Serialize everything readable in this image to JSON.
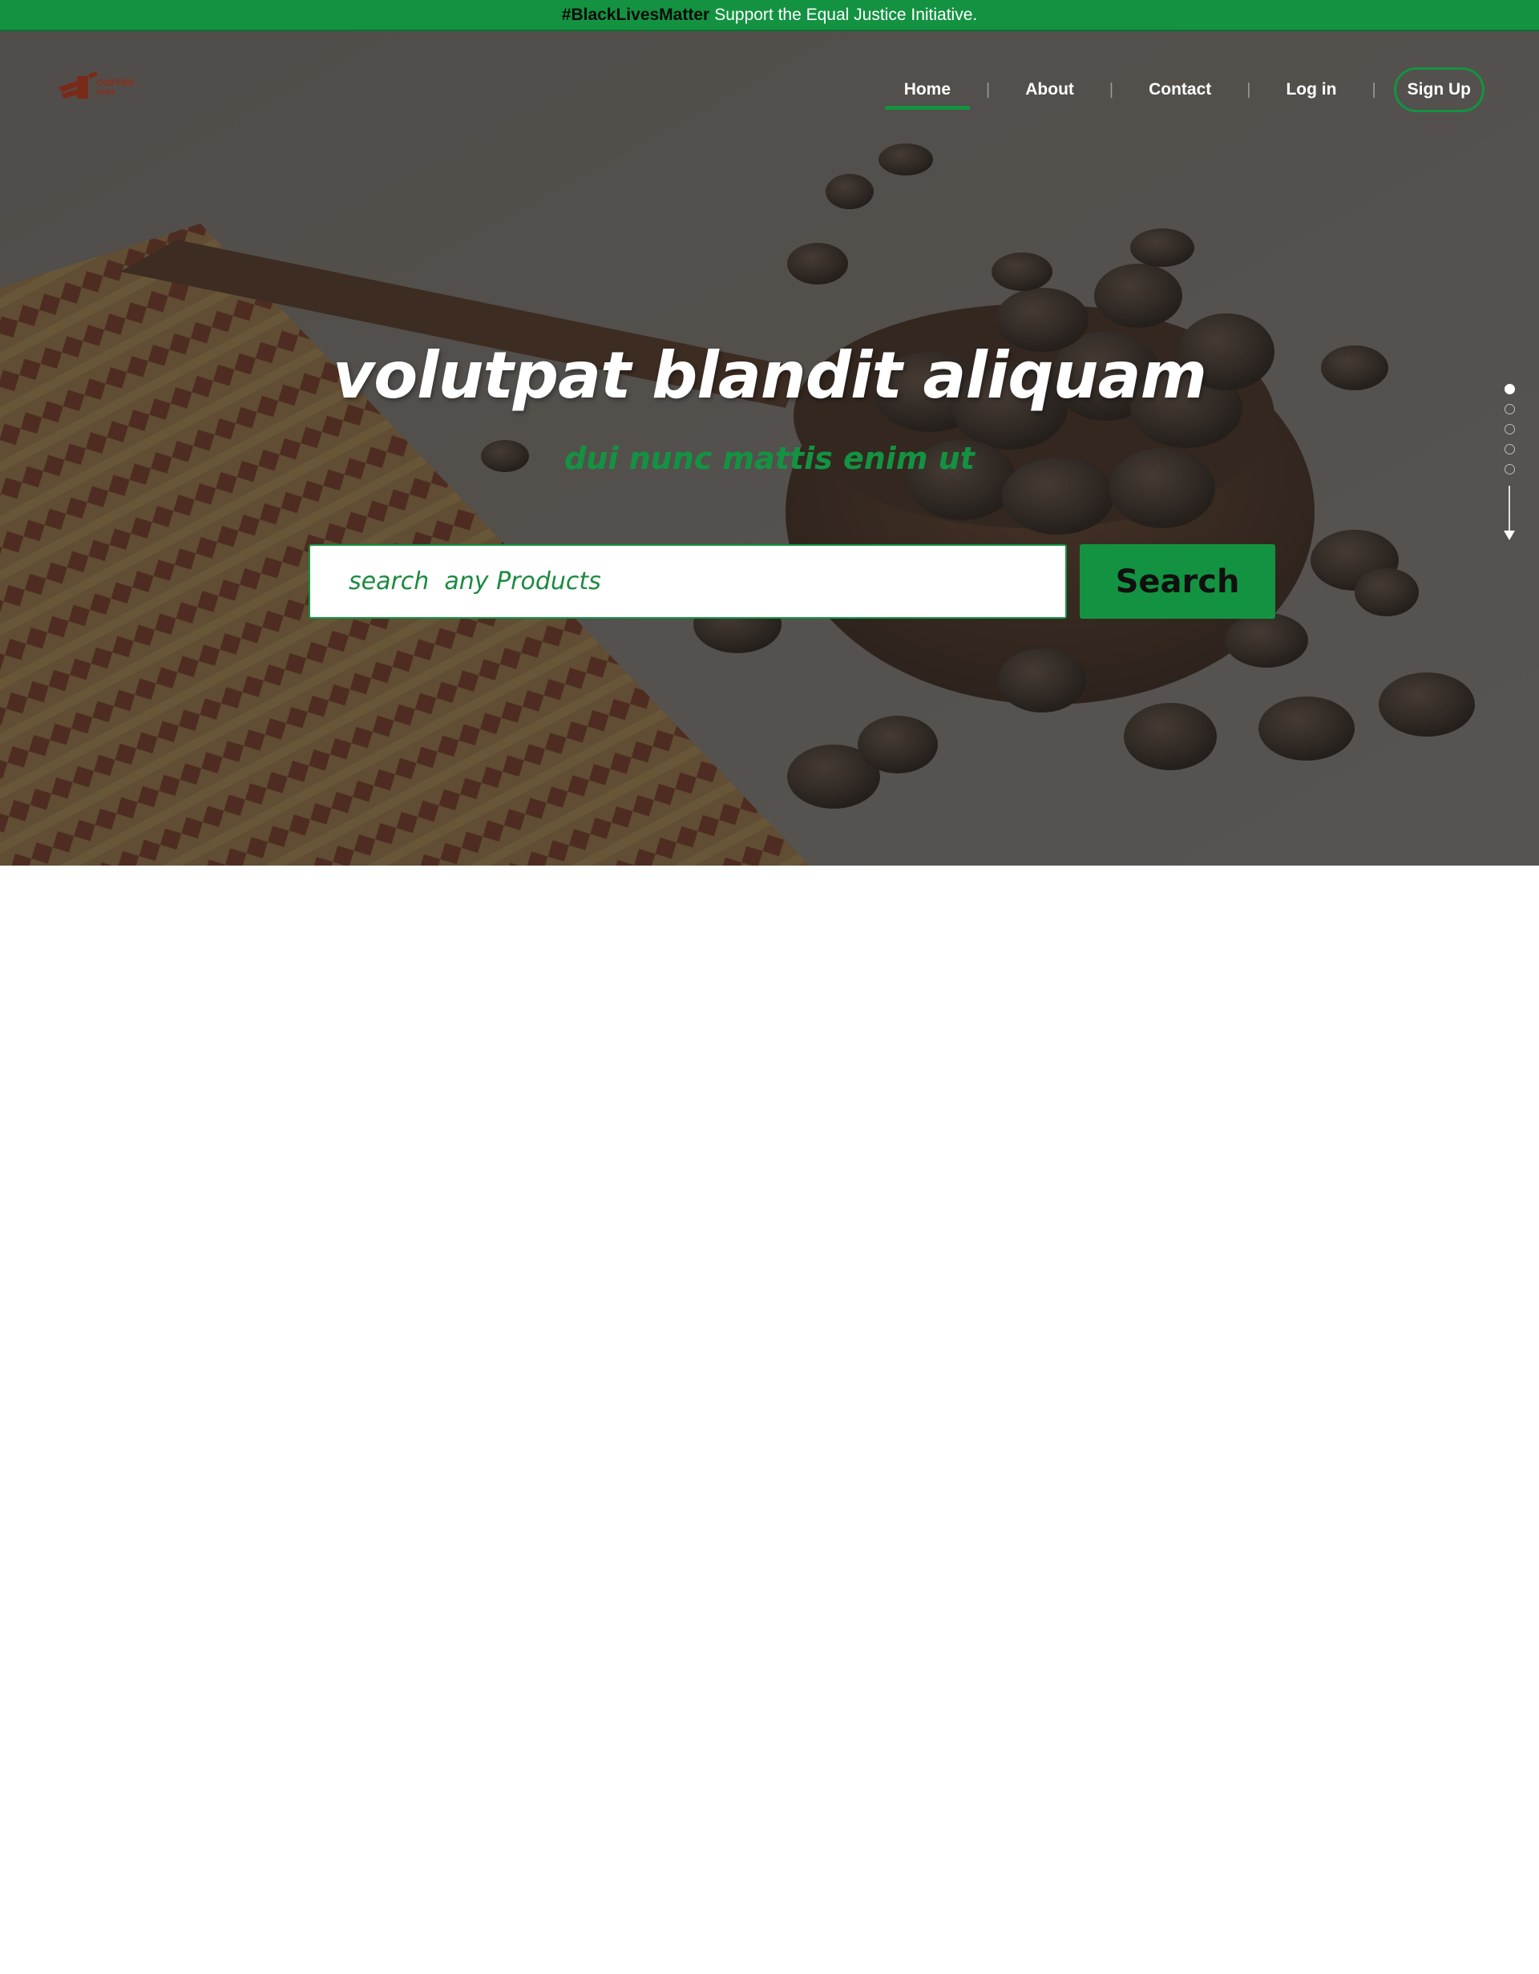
{
  "announcement": {
    "hashtag": "#BlackLivesMatter",
    "message": "Support the Equal Justice Initiative."
  },
  "brand": {
    "logo_line1": "COFFEE",
    "logo_line2": "PORT"
  },
  "nav": {
    "items": [
      {
        "label": "Home",
        "active": true
      },
      {
        "label": "About"
      },
      {
        "label": "Contact"
      },
      {
        "label": "Log in"
      }
    ],
    "separator": "|",
    "signup_label": "Sign Up"
  },
  "hero": {
    "title": "volutpat blandit aliquam",
    "subtitle": "dui nunc mattis enim ut"
  },
  "search": {
    "placeholder": "search  any Products",
    "button_label": "Search"
  },
  "slider": {
    "slide_count": 5,
    "active_index": 0
  },
  "colors": {
    "accent": "#139341",
    "hero_overlay": "#3c3a38"
  }
}
